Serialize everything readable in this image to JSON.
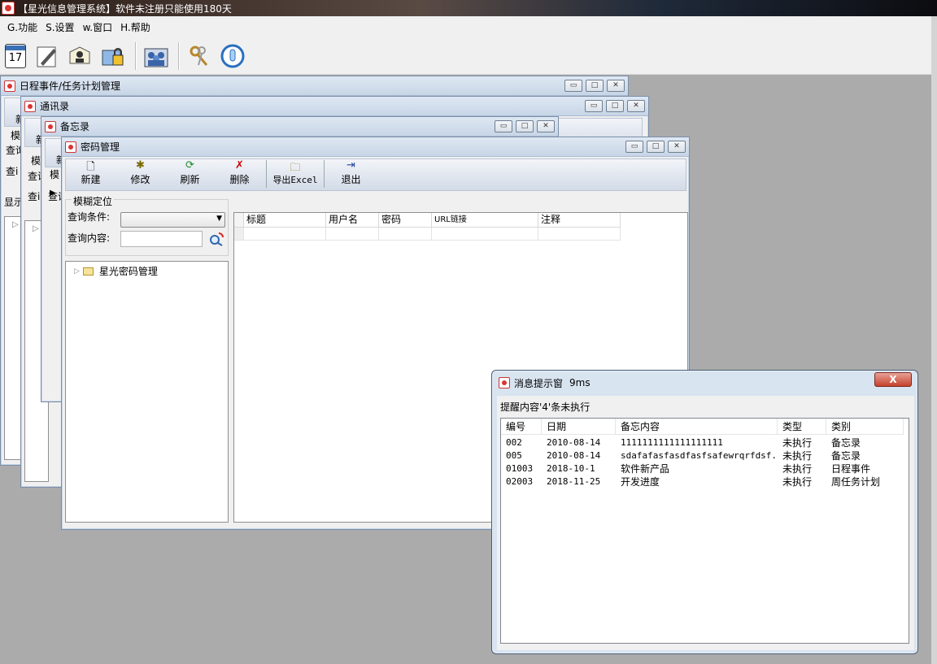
{
  "app": {
    "title": "【星光信息管理系统】软件未注册只能使用180天"
  },
  "menu": [
    "G.功能",
    "S.设置",
    "w.窗口",
    "H.帮助"
  ],
  "toolbar_icons": [
    "calendar-icon",
    "pen-edit-icon",
    "contacts-card-icon",
    "lock-folder-icon",
    "users-group-icon",
    "keys-icon",
    "info-icon"
  ],
  "calendar_day": "17",
  "windows": {
    "schedule": {
      "title": "日程事件/任务计划管理",
      "frag1": "新",
      "frag2": "模",
      "frag3": "查询",
      "frag4": "查i",
      "frag5": "显示",
      "frag6": "▷"
    },
    "contacts": {
      "title": "通讯录",
      "frag1": "新",
      "frag2": "模",
      "frag3": "查询",
      "frag4": "查i",
      "frag5": "▷"
    },
    "memo": {
      "title": "备忘录",
      "frag1": "新",
      "frag2": "模",
      "frag3": "查询",
      "frag4": "▶"
    }
  },
  "password_window": {
    "title": "密码管理",
    "toolbar": [
      {
        "label": "新建",
        "icon": "new-file-icon",
        "glyph": "🗋"
      },
      {
        "label": "修改",
        "icon": "edit-icon",
        "glyph": "✱"
      },
      {
        "label": "刷新",
        "icon": "refresh-icon",
        "glyph": "⟳"
      },
      {
        "label": "删除",
        "icon": "delete-icon",
        "glyph": "✗"
      },
      {
        "label": "导出Excel",
        "icon": "export-excel-icon",
        "glyph": "🗀"
      },
      {
        "label": "退出",
        "icon": "exit-icon",
        "glyph": "⇥"
      }
    ],
    "fuzzy_label": "模糊定位",
    "query_condition_label": "查询条件:",
    "query_condition_value": "",
    "query_content_label": "查询内容:",
    "query_content_value": "",
    "tree_root": "星光密码管理",
    "grid_columns": [
      "标题",
      "用户名",
      "密码",
      "URL链接",
      "注释"
    ]
  },
  "message_window": {
    "title": "消息提示窗",
    "time": "9ms",
    "summary": "提醒内容'4'条未执行",
    "columns": [
      "编号",
      "日期",
      "备忘内容",
      "类型",
      "类别"
    ],
    "rows": [
      {
        "id": "002",
        "date": "2010-08-14",
        "content": "1111111111111111111",
        "type": "未执行",
        "category": "备忘录"
      },
      {
        "id": "005",
        "date": "2010-08-14",
        "content": "sdafafasfasdfasfsafewrqrfdsf...",
        "type": "未执行",
        "category": "备忘录"
      },
      {
        "id": "01003",
        "date": "2018-10-1",
        "content": "软件新产品",
        "type": "未执行",
        "category": "日程事件"
      },
      {
        "id": "02003",
        "date": "2018-11-25",
        "content": "开发进度",
        "type": "未执行",
        "category": "周任务计划"
      }
    ],
    "close_glyph": "X"
  }
}
